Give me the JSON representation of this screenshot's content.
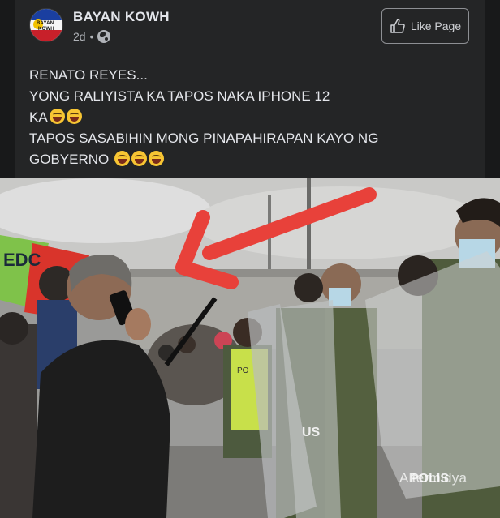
{
  "post": {
    "page_name": "BAYAN KOWH",
    "time": "2d",
    "dot": "•",
    "like_button": "Like Page",
    "avatar_text_1": "BAYAN",
    "avatar_text_2": "KOWH",
    "text_lines": [
      "RENATO REYES...",
      "YONG RALIYISTA KA TAPOS NAKA IPHONE 12",
      "KA",
      "TAPOS SASABIHIN MONG PINAPAHIRAPAN KAYO NG",
      "GOBYERNO"
    ]
  },
  "photo": {
    "banner_text": "EDC",
    "vest_text": "PO",
    "shield_text": "US",
    "shield_text_2": "POLIS",
    "watermark": "Altermidya",
    "arrow_color": "#e8413a"
  }
}
